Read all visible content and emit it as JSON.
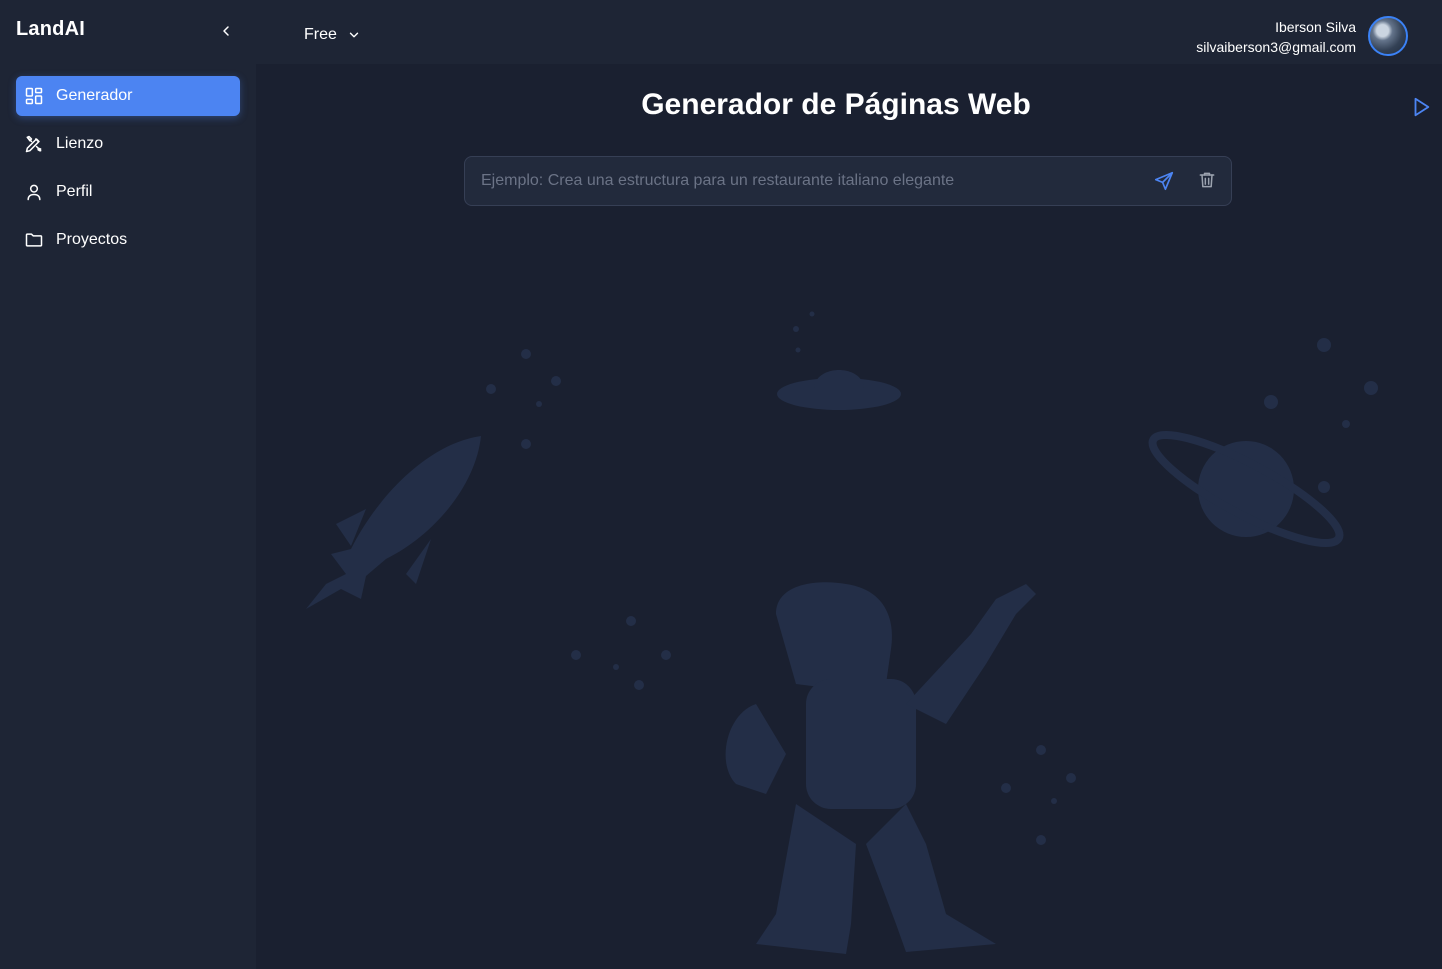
{
  "sidebar": {
    "brand": "LandAI",
    "collapse_icon": "chevron-left-icon",
    "items": [
      {
        "label": "Generador",
        "icon": "grid-icon",
        "active": true
      },
      {
        "label": "Lienzo",
        "icon": "tools-icon",
        "active": false
      },
      {
        "label": "Perfil",
        "icon": "user-icon",
        "active": false
      },
      {
        "label": "Proyectos",
        "icon": "folder-icon",
        "active": false
      }
    ]
  },
  "header": {
    "plan_label": "Free",
    "plan_icon": "chevron-down-icon",
    "user": {
      "name": "Iberson Silva",
      "email": "silvaiberson3@gmail.com"
    }
  },
  "main": {
    "title": "Generador de Páginas Web",
    "prompt": {
      "value": "",
      "placeholder": "Ejemplo: Crea una estructura para un restaurante italiano elegante",
      "send_icon": "send-icon",
      "clear_icon": "trash-icon"
    },
    "run_icon": "play-icon",
    "illustration": "space-astronaut-illustration"
  },
  "colors": {
    "background": "#1a2030",
    "sidebar": "#1e2535",
    "accent": "#4c84f2",
    "illustration": "#232e47"
  }
}
